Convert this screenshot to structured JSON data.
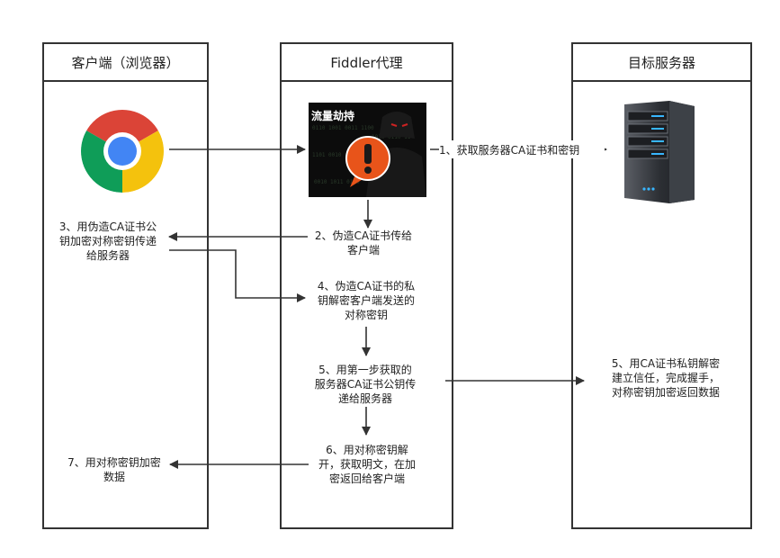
{
  "lanes": {
    "client": "客户端（浏览器）",
    "proxy": "Fiddler代理",
    "server": "目标服务器"
  },
  "hijack_badge": "流量劫持",
  "steps": {
    "s1": "1、获取服务器CA证书和密钥",
    "s2": [
      "2、伪造CA证书传给",
      "客户端"
    ],
    "s3": [
      "3、用伪造CA证书公",
      "钥加密对称密钥传递",
      "给服务器"
    ],
    "s4": [
      "4、伪造CA证书的私",
      "钥解密客户端发送的",
      "对称密钥"
    ],
    "s5a": [
      "5、用第一步获取的",
      "服务器CA证书公钥传",
      "递给服务器"
    ],
    "s5b": [
      "5、用CA证书私钥解密",
      "建立信任，完成握手，",
      "对称密钥加密返回数据"
    ],
    "s6": [
      "6、用对称密钥解",
      "开，获取明文，在加",
      "密返回给客户端"
    ],
    "s7": [
      "7、用对称密钥加密",
      "数据"
    ]
  },
  "icons": {
    "browser": "chrome-browser-icon",
    "hacker": "hacker-warning-icon",
    "server": "server-rack-icon"
  }
}
